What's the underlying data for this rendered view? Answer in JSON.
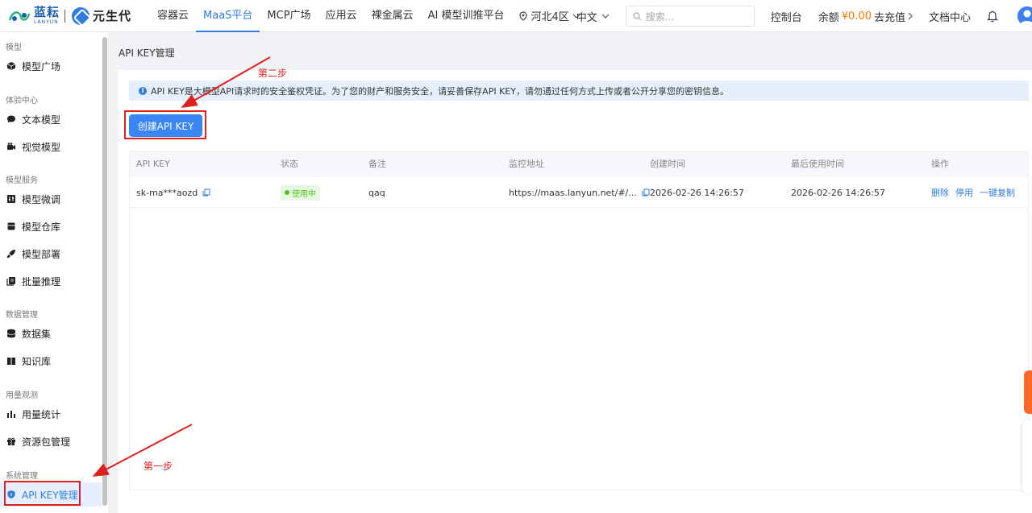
{
  "header": {
    "logo_text": "蓝耘",
    "logo_sub": "LANYUN",
    "logo2_text": "元生代",
    "nav": [
      "容器云",
      "MaaS平台",
      "MCP广场",
      "应用云",
      "裸金属云",
      "AI 模型训推平台"
    ],
    "active_nav": "MaaS平台",
    "region": "河北4区",
    "language": "中文",
    "search_placeholder": "搜索...",
    "console": "控制台",
    "balance_label": "余额",
    "balance_amount": "¥0.00",
    "recharge": "去充值",
    "docs": "文档中心"
  },
  "sidebar": {
    "groups": [
      {
        "title": "模型",
        "items": [
          {
            "label": "模型广场",
            "icon": "cube-icon"
          }
        ]
      },
      {
        "title": "体验中心",
        "items": [
          {
            "label": "文本模型",
            "icon": "chat-icon"
          },
          {
            "label": "视觉模型",
            "icon": "camera-icon"
          }
        ]
      },
      {
        "title": "模型服务",
        "items": [
          {
            "label": "模型微调",
            "icon": "tune-icon"
          },
          {
            "label": "模型仓库",
            "icon": "database-box-icon"
          },
          {
            "label": "模型部署",
            "icon": "rocket-icon"
          },
          {
            "label": "批量推理",
            "icon": "batch-icon"
          }
        ]
      },
      {
        "title": "数据管理",
        "items": [
          {
            "label": "数据集",
            "icon": "dataset-icon"
          },
          {
            "label": "知识库",
            "icon": "book-icon"
          }
        ]
      },
      {
        "title": "用量观测",
        "items": [
          {
            "label": "用量统计",
            "icon": "bar-chart-icon"
          },
          {
            "label": "资源包管理",
            "icon": "gift-icon"
          }
        ]
      },
      {
        "title": "系统管理",
        "items": [
          {
            "label": "API KEY管理",
            "icon": "shield-icon",
            "active": true
          }
        ]
      }
    ]
  },
  "main": {
    "title": "API KEY管理",
    "alert": "API KEY是大模型API请求时的安全鉴权凭证。为了您的财产和服务安全，请妥善保存API KEY，请勿通过任何方式上传或者公开分享您的密钥信息。",
    "create_button": "创建API KEY",
    "table": {
      "columns": [
        "API KEY",
        "状态",
        "备注",
        "监控地址",
        "创建时间",
        "最后使用时间",
        "操作"
      ],
      "rows": [
        {
          "api_key": "sk-ma***aozd",
          "status": "使用中",
          "remark": "qaq",
          "monitor_url": "https://maas.lanyun.net/#/...",
          "created": "2026-02-26 14:26:57",
          "last_used": "2026-02-26 14:26:57",
          "actions": [
            "删除",
            "停用",
            "一键复制"
          ]
        }
      ]
    }
  },
  "annotations": {
    "step1": "第一步",
    "step2": "第二步",
    "color": "#e02020"
  },
  "colors": {
    "accent": "#2f7de1",
    "button": "#3b86f5",
    "status_green": "#52c41a",
    "balance_orange": "#ff7a00"
  }
}
